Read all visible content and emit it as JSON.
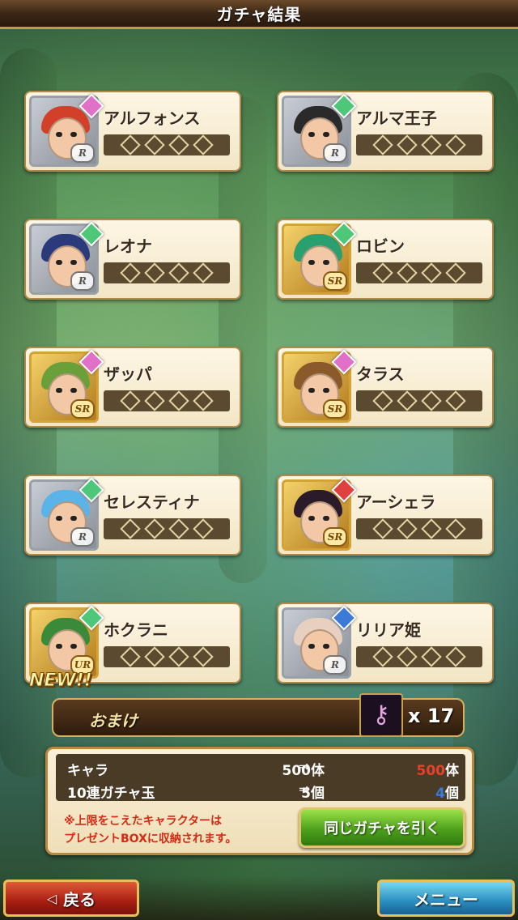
{
  "header": {
    "title": "ガチャ結果"
  },
  "characters": [
    {
      "name": "アルフォンス",
      "rank": "R",
      "gem_color": "#e070c8",
      "hair_color": "#d2402a",
      "is_new": false
    },
    {
      "name": "アルマ王子",
      "rank": "R",
      "gem_color": "#4ec878",
      "hair_color": "#2a2a2a",
      "is_new": false
    },
    {
      "name": "レオナ",
      "rank": "R",
      "gem_color": "#4ec878",
      "hair_color": "#2a3a7a",
      "is_new": false
    },
    {
      "name": "ロビン",
      "rank": "SR",
      "gem_color": "#4ec878",
      "hair_color": "#2aa070",
      "is_new": false
    },
    {
      "name": "ザッパ",
      "rank": "SR",
      "gem_color": "#e070c8",
      "hair_color": "#6aa03a",
      "is_new": false
    },
    {
      "name": "タラス",
      "rank": "SR",
      "gem_color": "#e070c8",
      "hair_color": "#8a5a2a",
      "is_new": false
    },
    {
      "name": "セレスティナ",
      "rank": "R",
      "gem_color": "#4ec878",
      "hair_color": "#5ab4e8",
      "is_new": false
    },
    {
      "name": "アーシェラ",
      "rank": "SR",
      "gem_color": "#e04040",
      "hair_color": "#2a1a2a",
      "is_new": false
    },
    {
      "name": "ホクラニ",
      "rank": "UR",
      "gem_color": "#4ec878",
      "hair_color": "#3a8a3a",
      "is_new": true
    },
    {
      "name": "リリア姫",
      "rank": "R",
      "gem_color": "#3a7ad8",
      "hair_color": "#e8d0c0",
      "is_new": false
    }
  ],
  "new_label": "NEW!!",
  "bonus": {
    "label": "おまけ",
    "item_icon": "key-icon",
    "count": "x 17"
  },
  "stats": [
    {
      "label": "キャラ",
      "before": "500体",
      "arrow": "⇒",
      "after_num": "500",
      "after_unit": "体",
      "after_color": "red"
    },
    {
      "label": "10連ガチャ玉",
      "before": "5個",
      "arrow": "⇒",
      "after_num": "4",
      "after_unit": "個",
      "after_color": "blue"
    }
  ],
  "note_line1": "※上限をこえたキャラクターは",
  "note_line2": "プレゼントBOXに収納されます。",
  "buttons": {
    "again": "同じガチャを引く",
    "back": "戻る",
    "menu": "メニュー"
  }
}
